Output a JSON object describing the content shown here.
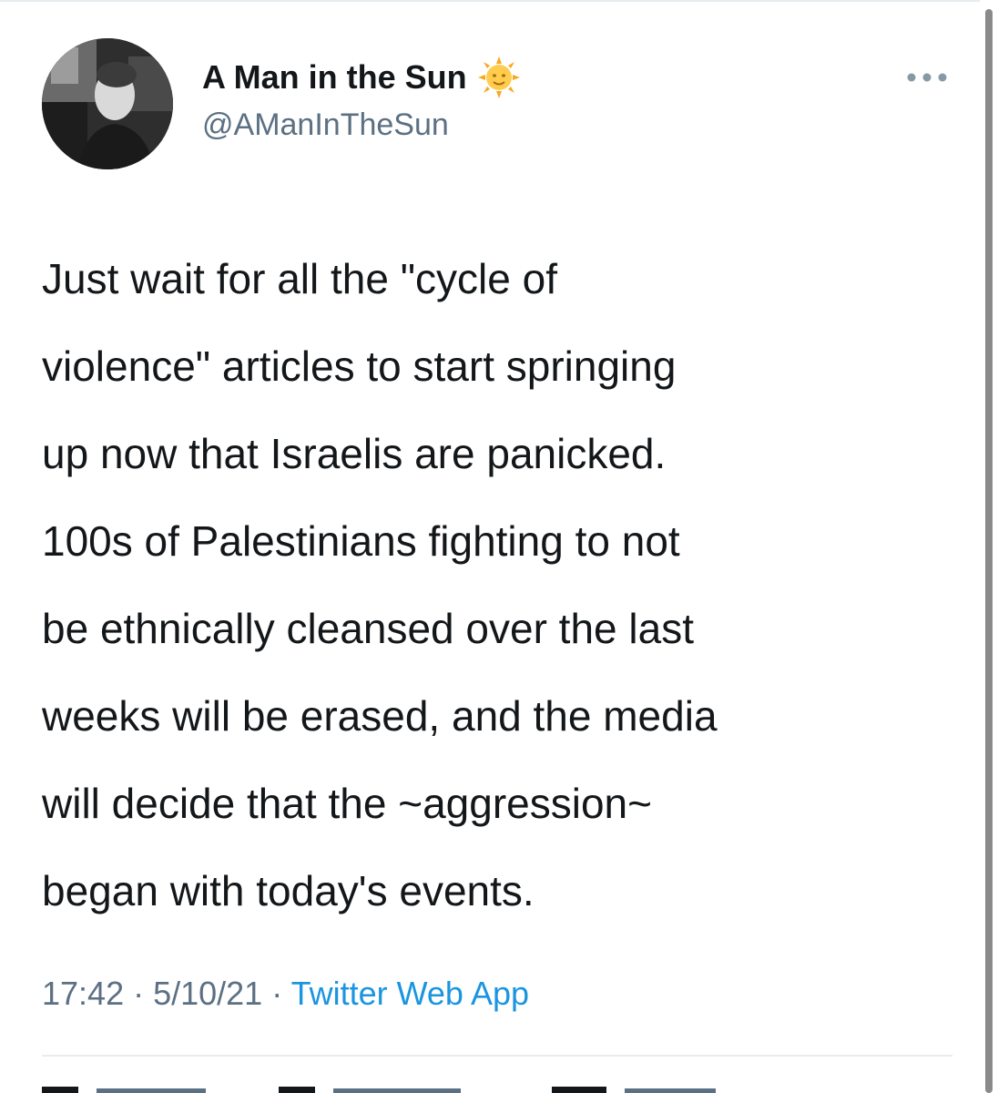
{
  "tweet": {
    "author": {
      "display_name": "A Man in the Sun",
      "handle": "@AManInTheSun",
      "emoji": "sun-with-face-icon"
    },
    "text_paragraphs": [
      [
        "Just wait for all the \"cycle of",
        "violence\" articles to start springing",
        "up now that Israelis are panicked."
      ],
      [
        "100s of Palestinians fighting to not",
        "be ethnically cleansed over the last",
        "weeks will be erased, and the media",
        "will decide that the ~aggression~",
        "began with today's events."
      ]
    ],
    "meta": {
      "time": "17:42",
      "separator1": " · ",
      "date": "5/10/21",
      "separator2": " · ",
      "source": "Twitter Web App"
    }
  },
  "colors": {
    "text": "#14171a",
    "secondary": "#5b7083",
    "link": "#1b95e0",
    "divider": "#e6ecf0"
  }
}
